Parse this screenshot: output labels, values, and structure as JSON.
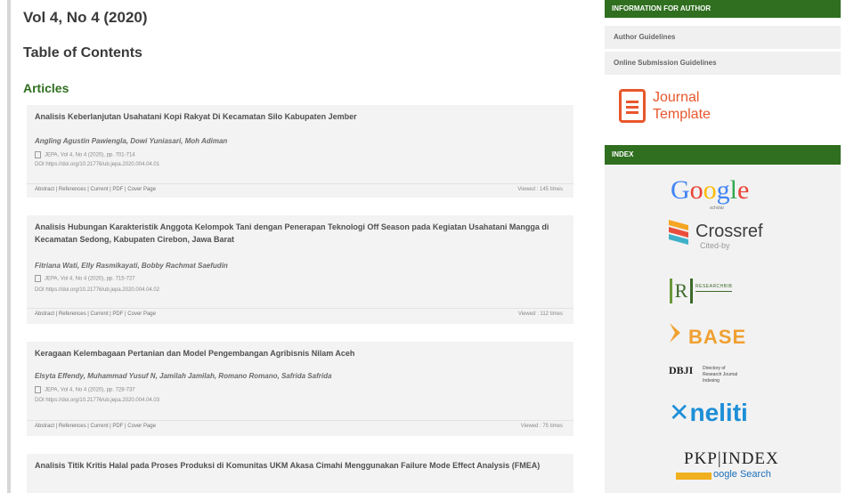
{
  "issue": {
    "title": "Vol 4, No 4 (2020)",
    "toc_heading": "Table of Contents",
    "section": "Articles"
  },
  "articles": [
    {
      "title": "Analisis Keberlanjutan Usahatani Kopi Rakyat Di Kecamatan Silo Kabupaten Jember",
      "authors": "Angling Agustin Pawiengla, Dowi Yuniasari, Moh Adiman",
      "citation": "JEPA, Vol 4, No 4 (2020), pp. 701-714",
      "doi": "DOI https://doi.org/10.21776/ub.jepa.2020.004.04.01",
      "links": "Abstract | References | Current | PDF | Cover Page",
      "views": "Viewed : 145 times"
    },
    {
      "title": "Analisis Hubungan Karakteristik Anggota Kelompok Tani dengan Penerapan Teknologi Off Season pada Kegiatan Usahatani Mangga di Kecamatan Sedong, Kabupaten Cirebon, Jawa Barat",
      "authors": "Fitriana Wati, Elly Rasmikayati, Bobby Rachmat Saefudin",
      "citation": "JEPA, Vol 4, No 4 (2020), pp. 715-727",
      "doi": "DOI https://doi.org/10.21776/ub.jepa.2020.004.04.02",
      "links": "Abstract | References | Current | PDF | Cover Page",
      "views": "Viewed : 112 times"
    },
    {
      "title": "Keragaan Kelembagaan Pertanian dan Model Pengembangan Agribisnis Nilam Aceh",
      "authors": "Elsyta Effendy, Muhammad Yusuf N, Jamilah Jamilah, Romano Romano, Safrida Safrida",
      "citation": "JEPA, Vol 4, No 4 (2020), pp. 728-737",
      "doi": "DOI https://doi.org/10.21776/ub.jepa.2020.004.04.03",
      "links": "Abstract | References | Current | PDF | Cover Page",
      "views": "Viewed : 75 times"
    },
    {
      "title": "Analisis Titik Kritis Halal pada Proses Produksi di Komunitas UKM Akasa Cimahi Menggunakan Failure Mode Effect Analysis (FMEA)"
    }
  ],
  "sidebar": {
    "info_header": "INFORMATION FOR AUTHOR",
    "author_guidelines": "Author Guidelines",
    "online_submission": "Online Submission Guidelines",
    "journal_template": {
      "line1": "Journal",
      "line2": "Template"
    },
    "index_header": "INDEX",
    "logos": {
      "google": {
        "g1": "G",
        "o1": "o",
        "o2": "o",
        "g2": "g",
        "l": "l",
        "e": "e",
        "sub": "scholar"
      },
      "crossref": {
        "name": "Crossref",
        "sub": "Cited-by"
      },
      "research": {
        "glyph": "R",
        "text": "RESEARCHBIB"
      },
      "base": {
        "name": "BASE"
      },
      "dbji": {
        "name": "DBJI",
        "text": "Directory of Research Journal Indexing"
      },
      "neliti": {
        "glyph": "✕",
        "name": "neliti"
      },
      "pkp": {
        "name": "PKP|INDEX"
      },
      "goo": {
        "name": "oogle Search"
      }
    },
    "colors": {
      "accent_green": "#2f6f1f",
      "template_orange": "#e8572c"
    }
  }
}
